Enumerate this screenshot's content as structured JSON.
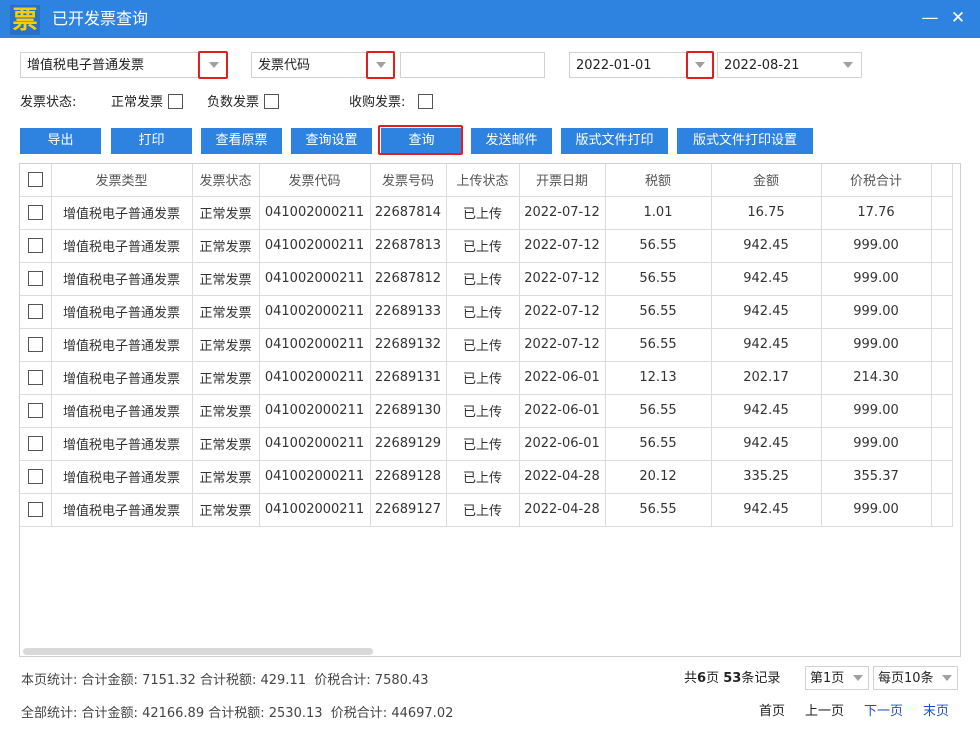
{
  "window": {
    "title": "已开发票查询",
    "logo_char": "票",
    "minimize": "—",
    "close": "✕"
  },
  "filters": {
    "invoice_type": "增值税电子普通发票",
    "search_field": "发票代码",
    "search_value": "",
    "date_from": "2022-01-01",
    "date_to": "2022-08-21"
  },
  "status_row": {
    "label": "发票状态:",
    "normal": "正常发票",
    "negative": "负数发票",
    "purchase": "收购发票:"
  },
  "toolbar": {
    "export": "导出",
    "print": "打印",
    "view_original": "查看原票",
    "query_settings": "查询设置",
    "query": "查询",
    "send_email": "发送邮件",
    "layout_print": "版式文件打印",
    "layout_print_settings": "版式文件打印设置"
  },
  "table": {
    "columns": [
      "发票类型",
      "发票状态",
      "发票代码",
      "发票号码",
      "上传状态",
      "开票日期",
      "税额",
      "金额",
      "价税合计"
    ],
    "rows": [
      [
        "增值税电子普通发票",
        "正常发票",
        "041002000211",
        "22687814",
        "已上传",
        "2022-07-12",
        "1.01",
        "16.75",
        "17.76"
      ],
      [
        "增值税电子普通发票",
        "正常发票",
        "041002000211",
        "22687813",
        "已上传",
        "2022-07-12",
        "56.55",
        "942.45",
        "999.00"
      ],
      [
        "增值税电子普通发票",
        "正常发票",
        "041002000211",
        "22687812",
        "已上传",
        "2022-07-12",
        "56.55",
        "942.45",
        "999.00"
      ],
      [
        "增值税电子普通发票",
        "正常发票",
        "041002000211",
        "22689133",
        "已上传",
        "2022-07-12",
        "56.55",
        "942.45",
        "999.00"
      ],
      [
        "增值税电子普通发票",
        "正常发票",
        "041002000211",
        "22689132",
        "已上传",
        "2022-07-12",
        "56.55",
        "942.45",
        "999.00"
      ],
      [
        "增值税电子普通发票",
        "正常发票",
        "041002000211",
        "22689131",
        "已上传",
        "2022-06-01",
        "12.13",
        "202.17",
        "214.30"
      ],
      [
        "增值税电子普通发票",
        "正常发票",
        "041002000211",
        "22689130",
        "已上传",
        "2022-06-01",
        "56.55",
        "942.45",
        "999.00"
      ],
      [
        "增值税电子普通发票",
        "正常发票",
        "041002000211",
        "22689129",
        "已上传",
        "2022-06-01",
        "56.55",
        "942.45",
        "999.00"
      ],
      [
        "增值税电子普通发票",
        "正常发票",
        "041002000211",
        "22689128",
        "已上传",
        "2022-04-28",
        "20.12",
        "335.25",
        "355.37"
      ],
      [
        "增值税电子普通发票",
        "正常发票",
        "041002000211",
        "22689127",
        "已上传",
        "2022-04-28",
        "56.55",
        "942.45",
        "999.00"
      ]
    ]
  },
  "summary": {
    "page": {
      "label": "本页统计:",
      "amount_label": "合计金额:",
      "amount": "7151.32",
      "tax_label": "合计税额:",
      "tax": "429.11",
      "total_label": "价税合计:",
      "total": "7580.43"
    },
    "all": {
      "label": "全部统计:",
      "amount_label": "合计金额:",
      "amount": "42166.89",
      "tax_label": "合计税额:",
      "tax": "2530.13",
      "total_label": "价税合计:",
      "total": "44697.02"
    }
  },
  "pager": {
    "prefix": "共",
    "pages": "6",
    "pages_unit": "页",
    "records": "53",
    "records_unit": "条记录",
    "current_page": "第1页",
    "page_size": "每页10条",
    "first": "首页",
    "prev": "上一页",
    "next": "下一页",
    "last": "末页"
  },
  "colors": {
    "titlebar": "#2e83e0",
    "button": "#2e83e0",
    "highlight": "#e02020",
    "link": "#1a4fd6"
  }
}
